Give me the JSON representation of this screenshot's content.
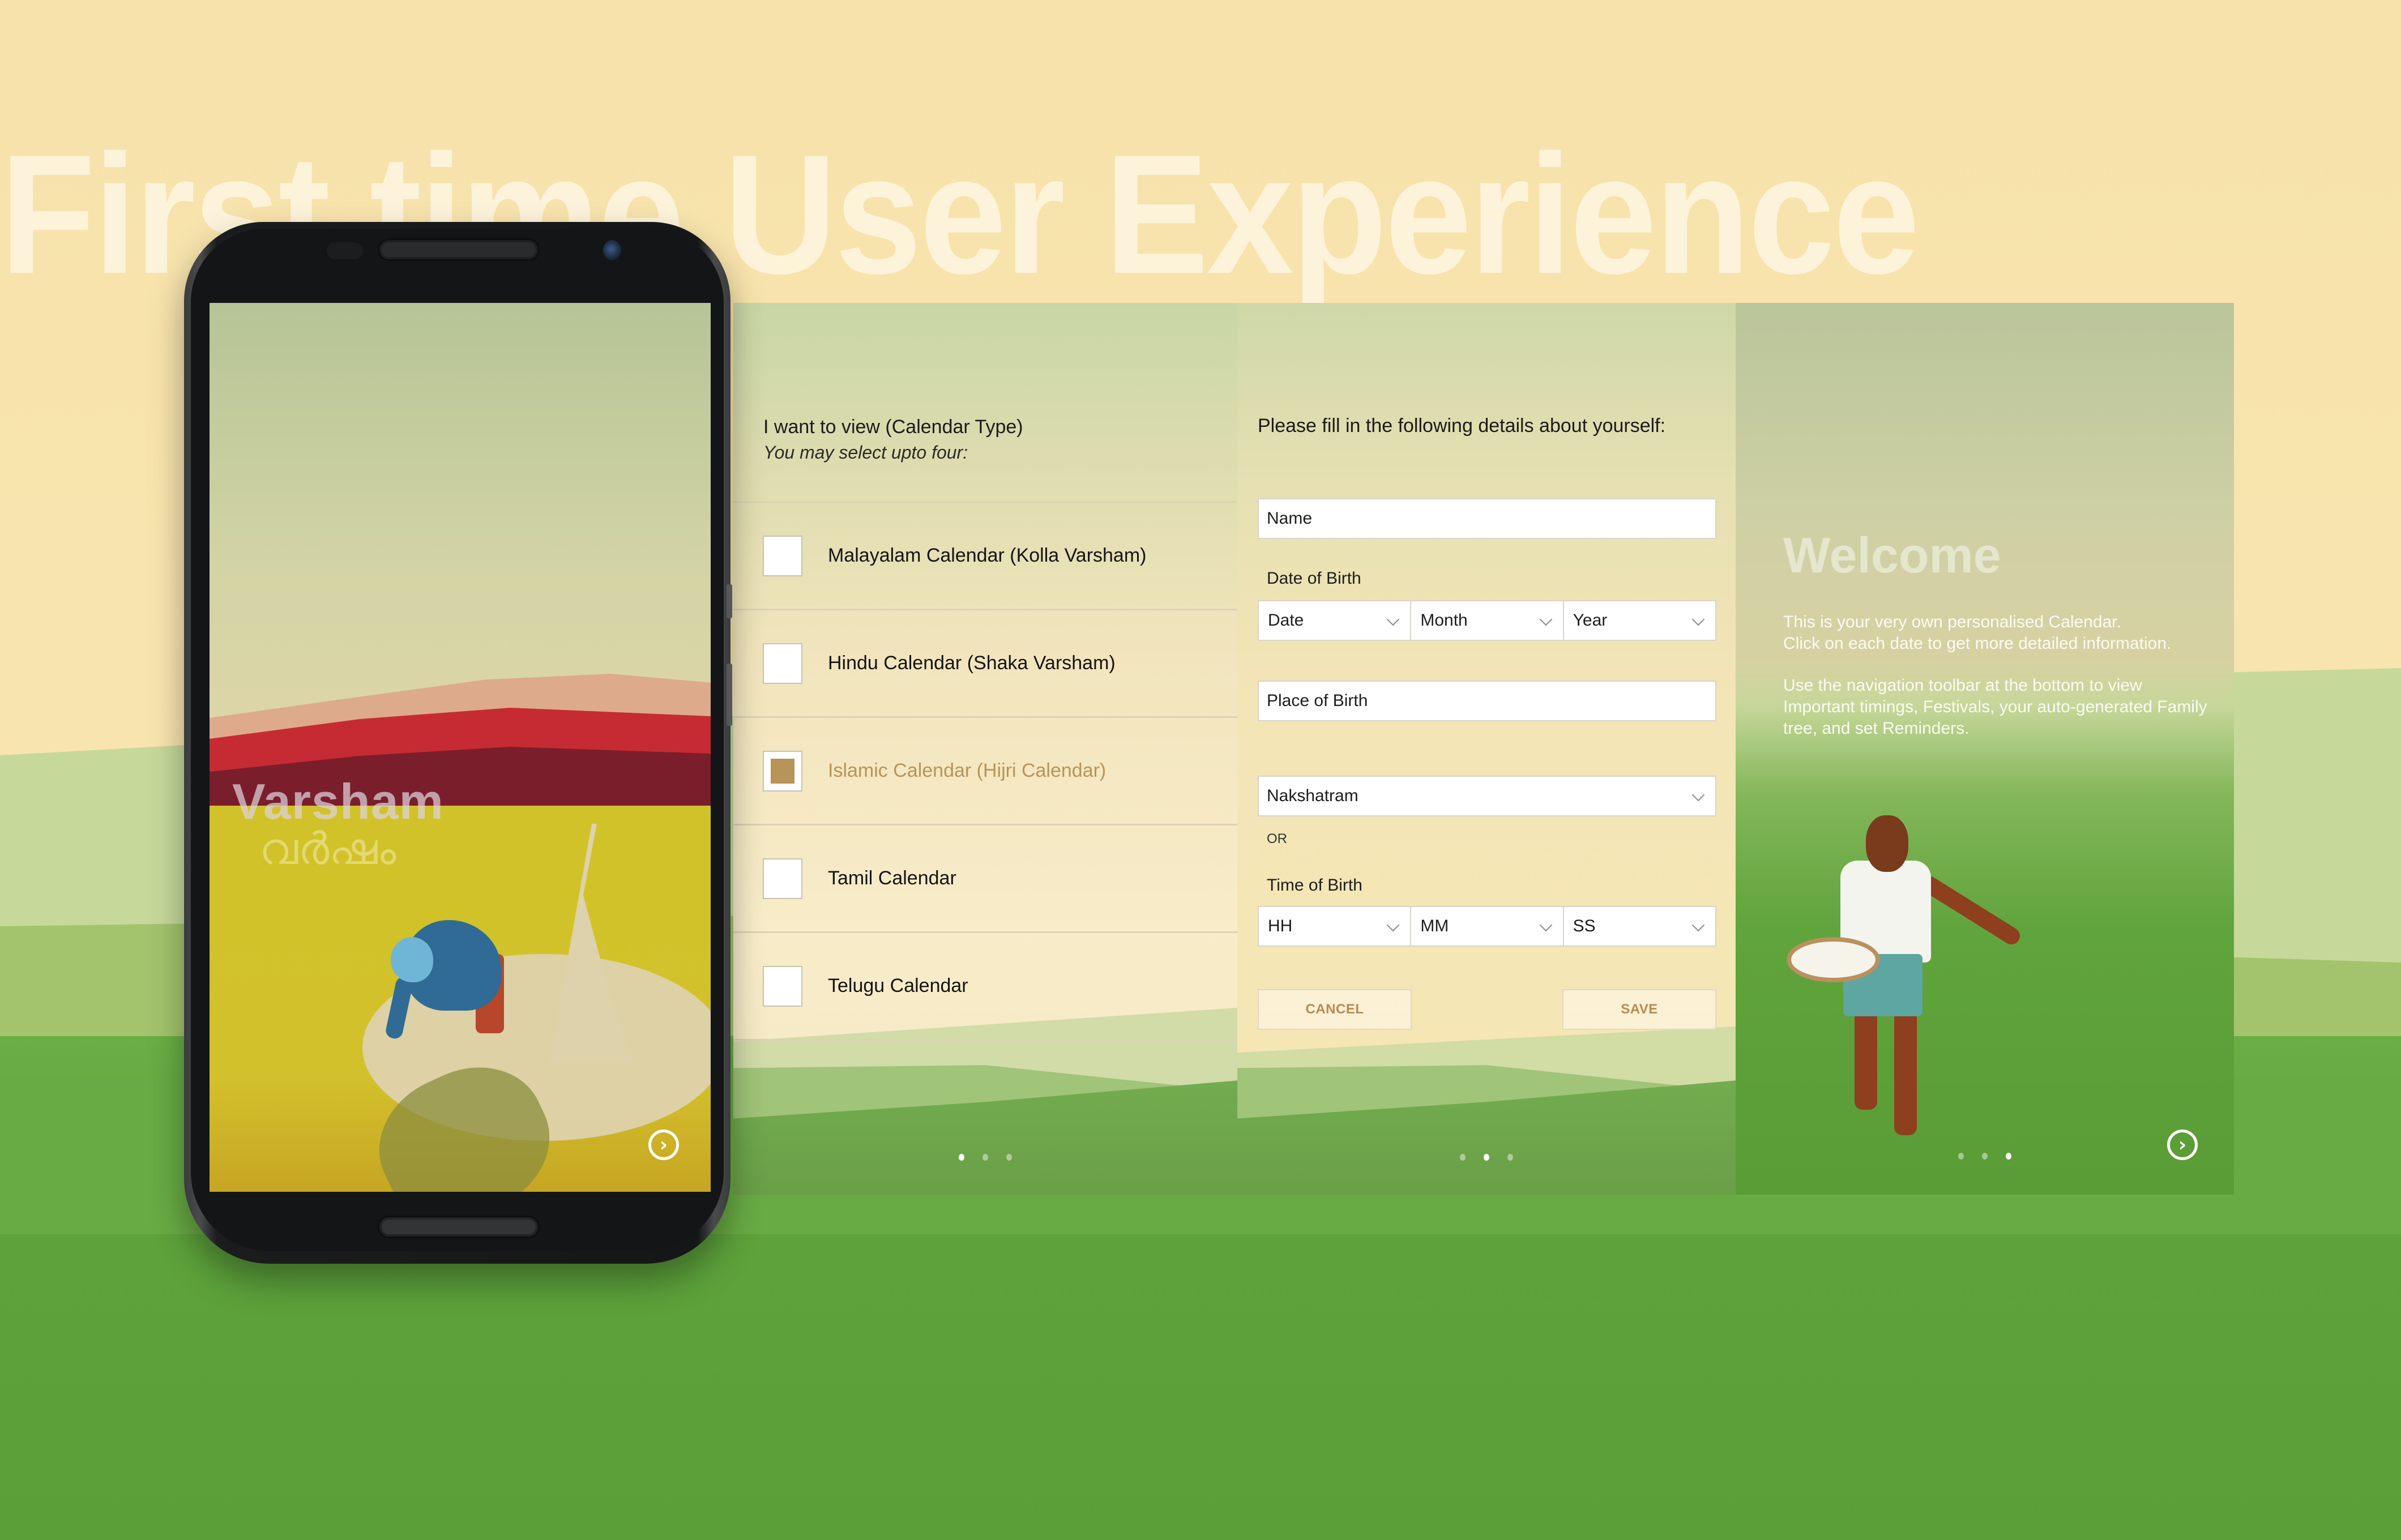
{
  "headline": "First time User Experience",
  "phone": {
    "app_title": "Varsham",
    "app_title_malayalam": "വർഷം",
    "next_icon": "chevron-circle-right-icon"
  },
  "calendar_panel": {
    "heading": "I want to view (Calendar Type)",
    "subheading": "You may select upto four:",
    "options": [
      {
        "label": "Malayalam Calendar (Kolla Varsham)",
        "checked": false
      },
      {
        "label": "Hindu Calendar (Shaka Varsham)",
        "checked": false
      },
      {
        "label": "Islamic Calendar (Hijri Calendar)",
        "checked": true
      },
      {
        "label": "Tamil Calendar",
        "checked": false
      },
      {
        "label": "Telugu Calendar",
        "checked": false
      }
    ],
    "page_indicator": {
      "total": 3,
      "active": 1
    }
  },
  "form_panel": {
    "heading": "Please fill in the following details about yourself:",
    "name_placeholder": "Name",
    "dob_label": "Date of Birth",
    "dob_selects": [
      "Date",
      "Month",
      "Year"
    ],
    "place_placeholder": "Place of Birth",
    "nakshatram_select": "Nakshatram",
    "or_label": "OR",
    "tob_label": "Time of Birth",
    "tob_selects": [
      "HH",
      "MM",
      "SS"
    ],
    "cancel_label": "CANCEL",
    "save_label": "SAVE",
    "page_indicator": {
      "total": 3,
      "active": 2
    }
  },
  "welcome_panel": {
    "title": "Welcome",
    "paragraph1_line1": "This is your very own personalised Calendar.",
    "paragraph1_line2": "Click on each date to get more detailed information.",
    "paragraph2": "Use the navigation toolbar at the bottom to view Important timings, Festivals, your auto-generated Family tree, and set Reminders.",
    "page_indicator": {
      "total": 3,
      "active": 3
    },
    "next_icon": "chevron-circle-right-icon"
  },
  "colors": {
    "accent": "#b89458",
    "background_cream": "#f7e2ab",
    "field_green": "#5fa33b",
    "text_dark": "#1b1b1b"
  }
}
